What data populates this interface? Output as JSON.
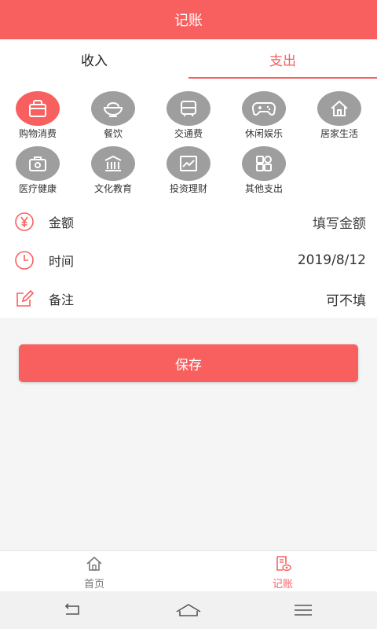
{
  "header": {
    "title": "记账"
  },
  "tabs": [
    {
      "label": "收入"
    },
    {
      "label": "支出"
    }
  ],
  "active_tab": "支出",
  "categories": [
    {
      "label": "购物消费",
      "icon": "shopping-bag-icon",
      "active": true
    },
    {
      "label": "餐饮",
      "icon": "food-bowl-icon",
      "active": false
    },
    {
      "label": "交通费",
      "icon": "bus-icon",
      "active": false
    },
    {
      "label": "休闲娱乐",
      "icon": "gamepad-icon",
      "active": false
    },
    {
      "label": "居家生活",
      "icon": "house-icon",
      "active": false
    },
    {
      "label": "医疗健康",
      "icon": "medical-kit-icon",
      "active": false
    },
    {
      "label": "文化教育",
      "icon": "library-icon",
      "active": false
    },
    {
      "label": "投资理财",
      "icon": "chart-icon",
      "active": false
    },
    {
      "label": "其他支出",
      "icon": "grid-icon",
      "active": false
    }
  ],
  "form": {
    "amount": {
      "label": "金额",
      "value": "填写金额",
      "icon": "yen-icon"
    },
    "time": {
      "label": "时间",
      "value": "2019/8/12",
      "icon": "clock-icon"
    },
    "note": {
      "label": "备注",
      "value": "可不填",
      "icon": "edit-icon"
    }
  },
  "save_label": "保存",
  "bottom_nav": [
    {
      "label": "首页",
      "icon": "home-icon",
      "active": false
    },
    {
      "label": "记账",
      "icon": "bookkeeping-icon",
      "active": true
    }
  ],
  "colors": {
    "accent": "#f8605f",
    "icon_inactive": "#9e9e9e"
  }
}
